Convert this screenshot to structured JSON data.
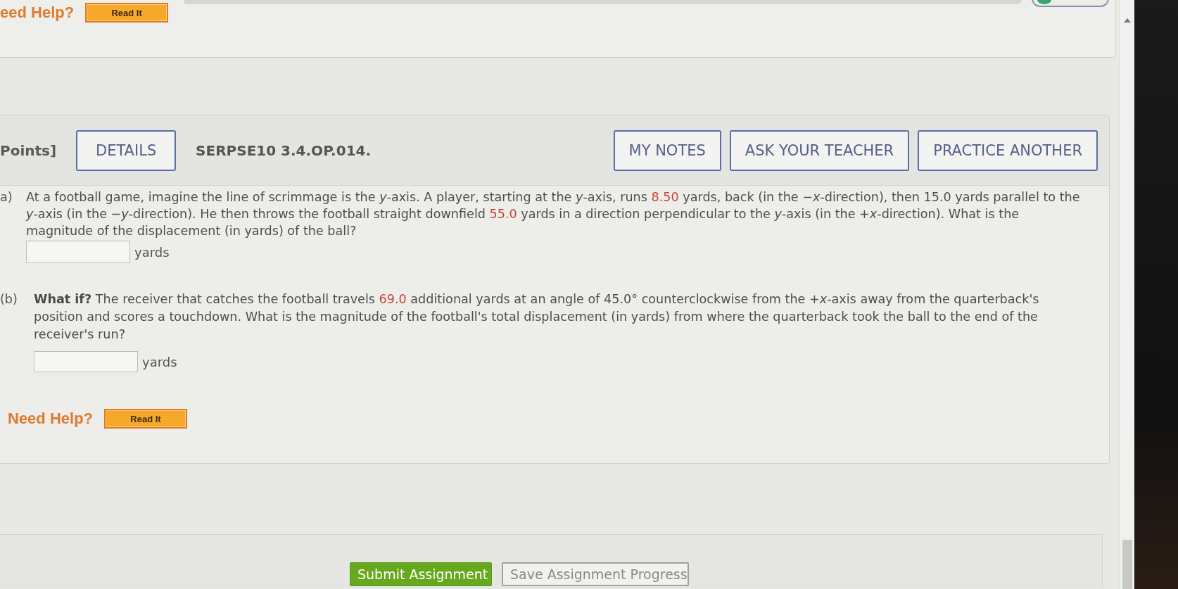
{
  "previous_question": {
    "help": {
      "label": "eed Help?",
      "button": "Read It"
    }
  },
  "question": {
    "points": "Points]",
    "details_button": "DETAILS",
    "code": "SERPSE10 3.4.OP.014.",
    "actions": [
      "MY NOTES",
      "ASK YOUR TEACHER",
      "PRACTICE ANOTHER"
    ],
    "parts": [
      {
        "label": "a)",
        "segments": [
          {
            "kind": "plain",
            "text": "At a football game, imagine the line of scrimmage is the *y*-axis. A player, starting at the *y*-axis, runs "
          },
          {
            "kind": "given",
            "text": "8.50"
          },
          {
            "kind": "plain",
            "text": " yards, back (in the −*x*-direction), then 15.0 yards parallel to the *y*-axis (in the −*y*-direction). He then throws the football straight downfield "
          },
          {
            "kind": "given",
            "text": "55.0"
          },
          {
            "kind": "plain",
            "text": " yards in a direction perpendicular to the *y*-axis (in the +*x*-direction). What is the magnitude of the displacement (in yards) of the ball?"
          }
        ],
        "unit": "yards"
      },
      {
        "label": "(b)",
        "segments": [
          {
            "kind": "plain",
            "text": "**What if?** The receiver that catches the football travels "
          },
          {
            "kind": "given",
            "text": "69.0"
          },
          {
            "kind": "plain",
            "text": " additional yards at an angle of 45.0° counterclockwise from the +*x*-axis away from the quarterback's position and scores a touchdown. What is the magnitude of the football's total displacement (in yards) from where the quarterback took the ball to the end of the receiver's run?"
          }
        ],
        "unit": "yards"
      }
    ],
    "help": {
      "label": "Need Help?",
      "button": "Read It"
    }
  },
  "footer": {
    "buttons": [
      {
        "label": "Submit Assignment",
        "kind": "primary"
      },
      {
        "label": "Save Assignment Progress",
        "kind": "secondary"
      }
    ]
  }
}
